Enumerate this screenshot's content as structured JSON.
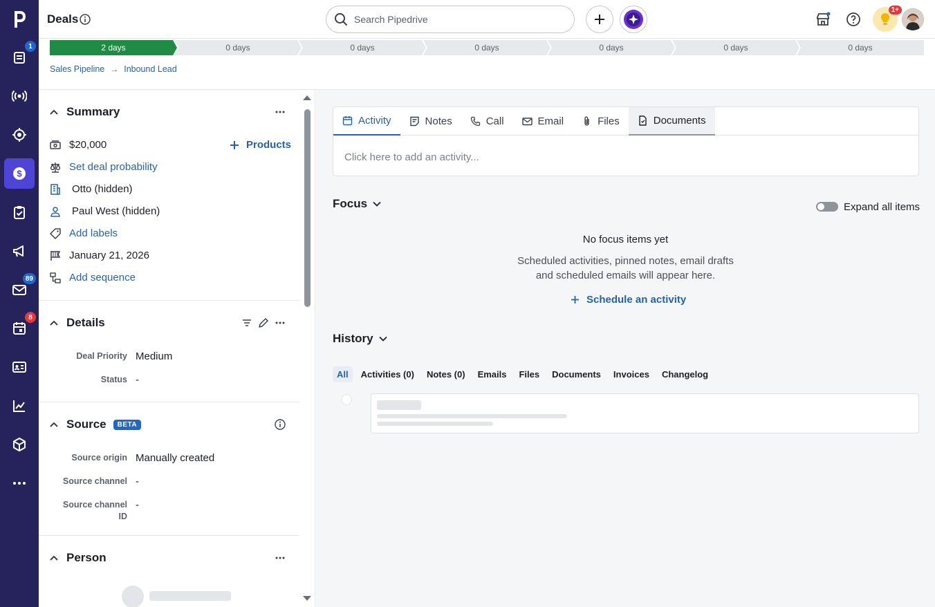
{
  "app": {
    "title": "Deals"
  },
  "nav": {
    "badges": {
      "leads": "1",
      "mail": "89",
      "calendar": "8"
    }
  },
  "topbar": {
    "search_placeholder": "Search Pipedrive",
    "notifications_badge": "1+"
  },
  "pipeline": {
    "stages": [
      "2 days",
      "0 days",
      "0 days",
      "0 days",
      "0 days",
      "0 days",
      "0 days"
    ],
    "current_stage_index": 0
  },
  "breadcrumb": {
    "pipeline": "Sales Pipeline",
    "stage": "Inbound Lead"
  },
  "summary": {
    "title": "Summary",
    "value": "$20,000",
    "products_label": "Products",
    "probability_link": "Set deal probability",
    "organization": "Otto (hidden)",
    "person": "Paul West (hidden)",
    "labels_link": "Add labels",
    "close_date": "January 21, 2026",
    "sequence_link": "Add sequence"
  },
  "details": {
    "title": "Details",
    "fields": [
      {
        "key": "Deal Priority",
        "value": "Medium"
      },
      {
        "key": "Status",
        "value": "-"
      }
    ]
  },
  "source": {
    "title": "Source",
    "badge": "BETA",
    "fields": [
      {
        "key": "Source origin",
        "value": "Manually created"
      },
      {
        "key": "Source channel",
        "value": "-"
      },
      {
        "key_line1": "Source channel",
        "key_line2": "ID",
        "value": "-"
      }
    ]
  },
  "person_section": {
    "title": "Person"
  },
  "composer": {
    "tabs": [
      "Activity",
      "Notes",
      "Call",
      "Email",
      "Files",
      "Documents"
    ],
    "placeholder": "Click here to add an activity..."
  },
  "focus": {
    "title": "Focus",
    "expand_label": "Expand all items",
    "empty_title": "No focus items yet",
    "empty_line1": "Scheduled activities, pinned notes, email drafts",
    "empty_line2": "and scheduled emails will appear here.",
    "schedule_link": "Schedule an activity"
  },
  "history": {
    "title": "History",
    "filters": [
      "All",
      "Activities (0)",
      "Notes (0)",
      "Emails",
      "Files",
      "Documents",
      "Invoices",
      "Changelog"
    ]
  },
  "colors": {
    "nav_bg": "#26235c",
    "nav_active": "#4e44d6",
    "stage_done": "#1f8b45",
    "link": "#2563a8"
  }
}
